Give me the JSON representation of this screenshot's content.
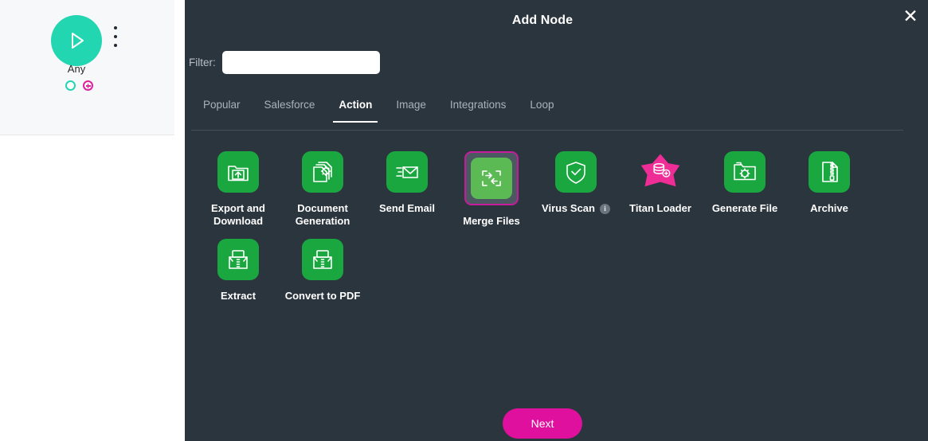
{
  "canvas": {
    "node": {
      "icon": "play-icon",
      "label": "Any",
      "menu_icon": "more-vertical-icon",
      "out_port": "output-port",
      "add_port": "add-node-port"
    }
  },
  "modal": {
    "title": "Add Node",
    "close_icon": "close-icon",
    "close_label": "✕",
    "filter": {
      "label": "Filter:",
      "value": "",
      "placeholder": ""
    },
    "tabs": [
      {
        "label": "Popular",
        "active": false
      },
      {
        "label": "Salesforce",
        "active": false
      },
      {
        "label": "Action",
        "active": true
      },
      {
        "label": "Image",
        "active": false
      },
      {
        "label": "Integrations",
        "active": false
      },
      {
        "label": "Loop",
        "active": false
      }
    ],
    "nodes": [
      {
        "label": "Export and Download",
        "icon": "folder-upload-icon",
        "selected": false,
        "info": false
      },
      {
        "label": "Document Generation",
        "icon": "documents-gear-icon",
        "selected": false,
        "info": false
      },
      {
        "label": "Send Email",
        "icon": "envelope-icon",
        "selected": false,
        "info": false
      },
      {
        "label": "Merge Files",
        "icon": "merge-arrows-icon",
        "selected": true,
        "info": false
      },
      {
        "label": "Virus Scan",
        "icon": "shield-check-icon",
        "selected": false,
        "info": true,
        "info_label": "i"
      },
      {
        "label": "Titan Loader",
        "icon": "star-database-icon",
        "selected": false,
        "info": false
      },
      {
        "label": "Generate File",
        "icon": "folder-gear-icon",
        "selected": false,
        "info": false
      },
      {
        "label": "Archive",
        "icon": "zip-document-icon",
        "selected": false,
        "info": false
      },
      {
        "label": "Extract",
        "icon": "extract-icon",
        "selected": false,
        "info": false
      },
      {
        "label": "Convert to PDF",
        "icon": "convert-pdf-icon",
        "selected": false,
        "info": false
      }
    ],
    "next_label": "Next"
  },
  "colors": {
    "modal_bg": "#2b353e",
    "icon_green": "#1aa73f",
    "selected_border": "#c71b9c",
    "accent_pink": "#e0109e",
    "node_teal": "#22d6b1"
  }
}
